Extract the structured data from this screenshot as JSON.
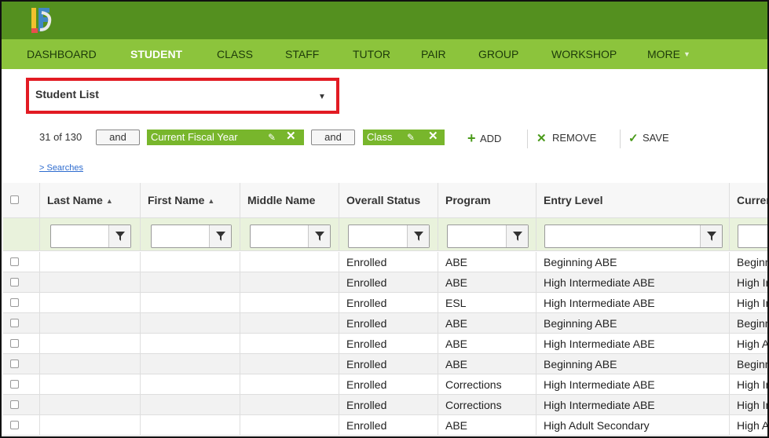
{
  "header": {
    "logo_icon": "ifs-logo-icon",
    "nav": [
      {
        "label": "DASHBOARD",
        "active": false
      },
      {
        "label": "STUDENT",
        "active": true
      },
      {
        "label": "CLASS",
        "active": false
      },
      {
        "label": "STAFF",
        "active": false
      },
      {
        "label": "TUTOR",
        "active": false
      },
      {
        "label": "PAIR",
        "active": false
      },
      {
        "label": "GROUP",
        "active": false
      },
      {
        "label": "WORKSHOP",
        "active": false
      },
      {
        "label": "MORE",
        "active": false
      }
    ]
  },
  "list_select": {
    "value": "Student List",
    "arrow_icon": "caret-down-icon"
  },
  "toolbar": {
    "count": "31 of 130",
    "and_1": "and",
    "filter_1": "Current Fiscal Year",
    "and_2": "and",
    "filter_2": "Class",
    "add": "ADD",
    "remove": "REMOVE",
    "save": "SAVE",
    "searches": "> Searches"
  },
  "table": {
    "columns": [
      {
        "label": "Last Name",
        "sorted": true
      },
      {
        "label": "First Name",
        "sorted": true
      },
      {
        "label": "Middle Name",
        "sorted": false
      },
      {
        "label": "Overall Status",
        "sorted": false
      },
      {
        "label": "Program",
        "sorted": false
      },
      {
        "label": "Entry Level",
        "sorted": false
      },
      {
        "label": "Curren",
        "sorted": false
      }
    ],
    "rows": [
      {
        "status": "Enrolled",
        "program": "ABE",
        "entry": "Beginning ABE",
        "current": "Beginn"
      },
      {
        "status": "Enrolled",
        "program": "ABE",
        "entry": "High Intermediate ABE",
        "current": "High In"
      },
      {
        "status": "Enrolled",
        "program": "ESL",
        "entry": "High Intermediate ABE",
        "current": "High In"
      },
      {
        "status": "Enrolled",
        "program": "ABE",
        "entry": "Beginning ABE",
        "current": "Beginn"
      },
      {
        "status": "Enrolled",
        "program": "ABE",
        "entry": "High Intermediate ABE",
        "current": "High A"
      },
      {
        "status": "Enrolled",
        "program": "ABE",
        "entry": "Beginning ABE",
        "current": "Beginn"
      },
      {
        "status": "Enrolled",
        "program": "Corrections",
        "entry": "High Intermediate ABE",
        "current": "High In"
      },
      {
        "status": "Enrolled",
        "program": "Corrections",
        "entry": "High Intermediate ABE",
        "current": "High In"
      },
      {
        "status": "Enrolled",
        "program": "ABE",
        "entry": "High Adult Secondary",
        "current": "High A"
      }
    ]
  },
  "colors": {
    "topbar": "#54901f",
    "nav": "#8cc43c",
    "chip": "#78b62c",
    "highlight": "#e21b23"
  }
}
